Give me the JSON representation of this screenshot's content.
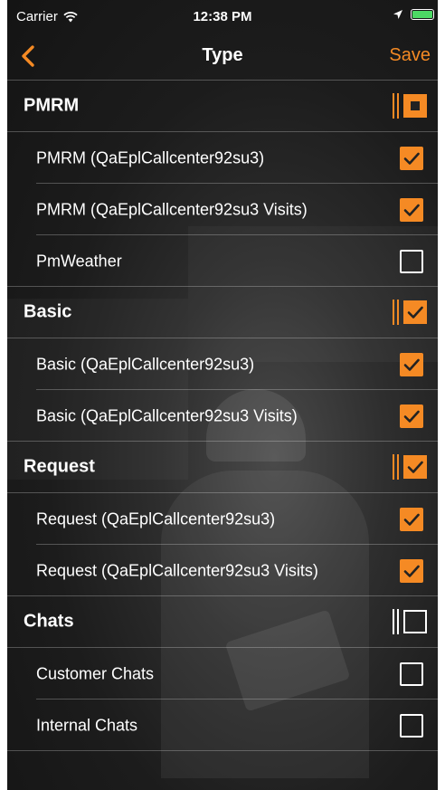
{
  "status_bar": {
    "carrier": "Carrier",
    "time": "12:38 PM"
  },
  "nav": {
    "back_icon": "chevron-left-icon",
    "title": "Type",
    "save_label": "Save"
  },
  "colors": {
    "accent": "#f58a24",
    "battery": "#4cd964"
  },
  "sections": [
    {
      "title": "PMRM",
      "state": "partial",
      "items": [
        {
          "label": "PMRM (QaEplCallcenter92su3)",
          "checked": true
        },
        {
          "label": "PMRM (QaEplCallcenter92su3 Visits)",
          "checked": true
        },
        {
          "label": "PmWeather",
          "checked": false
        }
      ]
    },
    {
      "title": "Basic",
      "state": "all",
      "items": [
        {
          "label": "Basic (QaEplCallcenter92su3)",
          "checked": true
        },
        {
          "label": "Basic (QaEplCallcenter92su3 Visits)",
          "checked": true
        }
      ]
    },
    {
      "title": "Request",
      "state": "all",
      "items": [
        {
          "label": "Request (QaEplCallcenter92su3)",
          "checked": true
        },
        {
          "label": "Request (QaEplCallcenter92su3 Visits)",
          "checked": true
        }
      ]
    },
    {
      "title": "Chats",
      "state": "none",
      "items": [
        {
          "label": "Customer Chats",
          "checked": false
        },
        {
          "label": "Internal Chats",
          "checked": false
        }
      ]
    }
  ]
}
